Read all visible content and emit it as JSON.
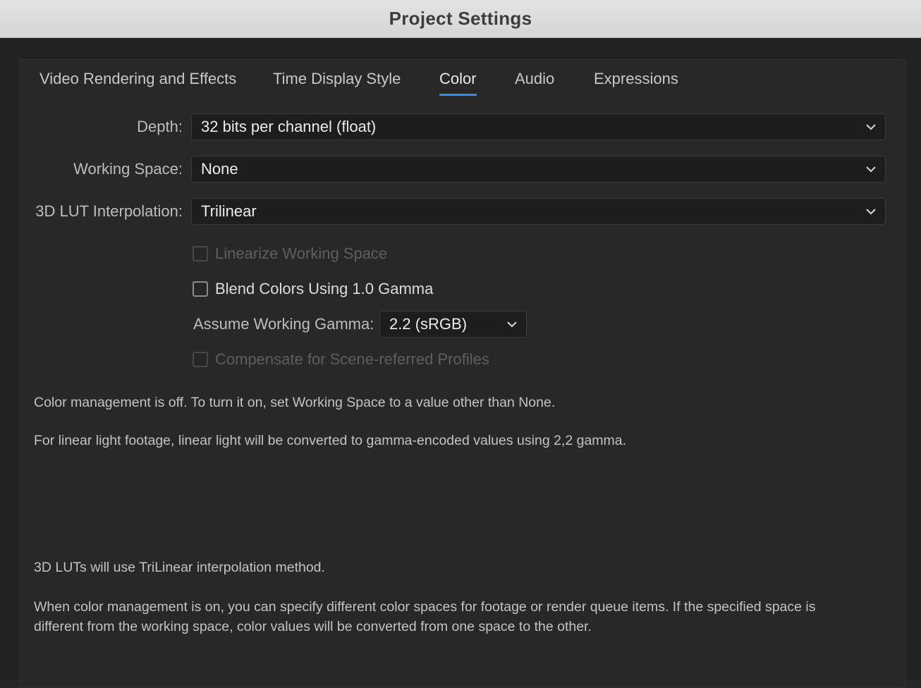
{
  "window": {
    "title": "Project Settings"
  },
  "tabs": [
    {
      "label": "Video Rendering and Effects",
      "active": false
    },
    {
      "label": "Time Display Style",
      "active": false
    },
    {
      "label": "Color",
      "active": true
    },
    {
      "label": "Audio",
      "active": false
    },
    {
      "label": "Expressions",
      "active": false
    }
  ],
  "colors": {
    "accent": "#2b8ef0",
    "titlebar": "#dcdcdc",
    "background": "#282828",
    "field": "#1d1d1d"
  },
  "form": {
    "depth": {
      "label": "Depth:",
      "value": "32 bits per channel (float)"
    },
    "working_space": {
      "label": "Working Space:",
      "value": "None"
    },
    "lut_interpolation": {
      "label": "3D LUT Interpolation:",
      "value": "Trilinear"
    },
    "linearize": {
      "label": "Linearize Working Space",
      "checked": false,
      "enabled": false
    },
    "blend_colors": {
      "label": "Blend Colors Using 1.0 Gamma",
      "checked": false,
      "enabled": true
    },
    "assume_gamma": {
      "label": "Assume Working Gamma:",
      "value": "2.2 (sRGB)"
    },
    "compensate": {
      "label": "Compensate for Scene-referred Profiles",
      "checked": false,
      "enabled": false
    }
  },
  "info": {
    "color_management_off": "Color management is off. To turn it on, set Working Space to a value other than None.",
    "linear_light": "For linear light footage, linear light will be converted to gamma-encoded values using 2,2 gamma.",
    "lut_method": "3D LUTs will use TriLinear interpolation method.",
    "color_spaces_line1": "When color management is on, you can specify different color spaces for footage or render queue items. If the specified space is",
    "color_spaces_line2": "different from the working space, color values will be converted from one space to the other."
  },
  "icons": {
    "dropdown": "chevron-down-icon",
    "checkbox": "checkbox-unchecked-icon"
  }
}
